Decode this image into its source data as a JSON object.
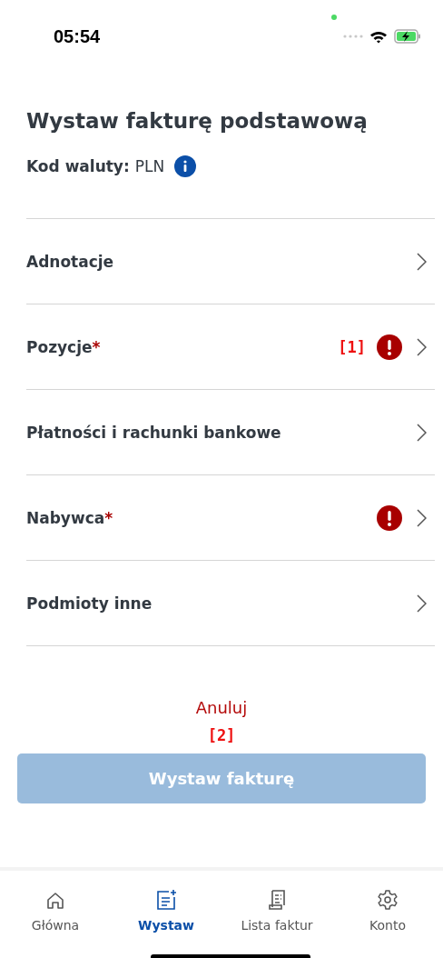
{
  "status_bar": {
    "time": "05:54"
  },
  "title": "Wystaw fakturę podstawową",
  "currency": {
    "label": "Kod waluty:",
    "value": "PLN"
  },
  "sections": [
    {
      "name": "Adnotacje",
      "error": false
    },
    {
      "name": "Pozycje",
      "required_mark": "*",
      "error": true,
      "annotation": "[1]"
    },
    {
      "name": "Płatności i rachunki bankowe",
      "error": false
    },
    {
      "name": "Nabywca",
      "required_mark": "*",
      "error": true
    },
    {
      "name": "Podmioty inne",
      "error": false
    }
  ],
  "cancel": "Anuluj",
  "cancel_annotation": "[2]",
  "submit": {
    "label": "Wystaw fakturę",
    "disabled": true
  },
  "tabs": [
    {
      "kind": "home",
      "label": "Główna",
      "selected": false
    },
    {
      "kind": "create",
      "label": "Wystaw",
      "selected": true
    },
    {
      "kind": "list",
      "label": "Lista faktur",
      "selected": false
    },
    {
      "kind": "settings",
      "label": "Konto",
      "selected": false
    }
  ]
}
